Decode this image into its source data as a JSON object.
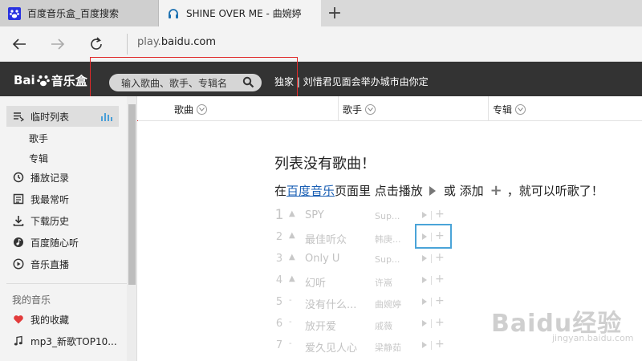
{
  "browser": {
    "tabs": [
      {
        "title": "百度音乐盒_百度搜索",
        "icon": "baidu-paw-icon"
      },
      {
        "title": "SHINE OVER ME - 曲婉婷",
        "icon": "headphones-icon"
      }
    ],
    "new_tab": "+",
    "url_prefix": "play.",
    "url_domain": "baidu.com"
  },
  "app": {
    "logo_left": "Bai",
    "logo_right": "音乐盒",
    "search_placeholder": "输入歌曲、歌手、专辑名",
    "promo": "独家 | 刘惜君见面会举办城市由你定"
  },
  "sidebar": {
    "items": [
      {
        "label": "临时列表",
        "icon": "playlist-icon"
      },
      {
        "label": "歌手"
      },
      {
        "label": "专辑"
      },
      {
        "label": "播放记录",
        "icon": "history-icon"
      },
      {
        "label": "我最常听",
        "icon": "frequent-icon"
      },
      {
        "label": "下载历史",
        "icon": "download-icon"
      },
      {
        "label": "百度随心听",
        "icon": "radio-icon"
      },
      {
        "label": "音乐直播",
        "icon": "live-icon"
      }
    ],
    "section_title": "我的音乐",
    "my_items": [
      {
        "label": "我的收藏",
        "icon": "heart-icon"
      },
      {
        "label": "mp3_新歌TOP10...",
        "icon": "music-note-icon"
      }
    ]
  },
  "table": {
    "columns": [
      "歌曲",
      "歌手",
      "专辑"
    ]
  },
  "empty": {
    "title": "列表没有歌曲！",
    "hint_pre": "在",
    "hint_link": "百度音乐",
    "hint_mid": "页面里 点击播放",
    "hint_or": "或 添加",
    "hint_post": "，就可以听歌了！"
  },
  "suggestions": [
    {
      "rank": "1",
      "trend": "▲",
      "song": "SPY",
      "artist": "Sup..."
    },
    {
      "rank": "2",
      "trend": "▲",
      "song": "最佳听众",
      "artist": "韩庚..."
    },
    {
      "rank": "3",
      "trend": "▲",
      "song": "Only U",
      "artist": "Sup..."
    },
    {
      "rank": "4",
      "trend": "▲",
      "song": "幻听",
      "artist": "许嵩"
    },
    {
      "rank": "5",
      "trend": "-",
      "song": "没有什么...",
      "artist": "曲婉婷"
    },
    {
      "rank": "6",
      "trend": "-",
      "song": "放开爱",
      "artist": "戚薇"
    },
    {
      "rank": "7",
      "trend": "-",
      "song": "爱久见人心",
      "artist": "梁静茹"
    }
  ],
  "watermark": {
    "text": "Baidu经验",
    "sub": "jingyan.baidu.com"
  }
}
